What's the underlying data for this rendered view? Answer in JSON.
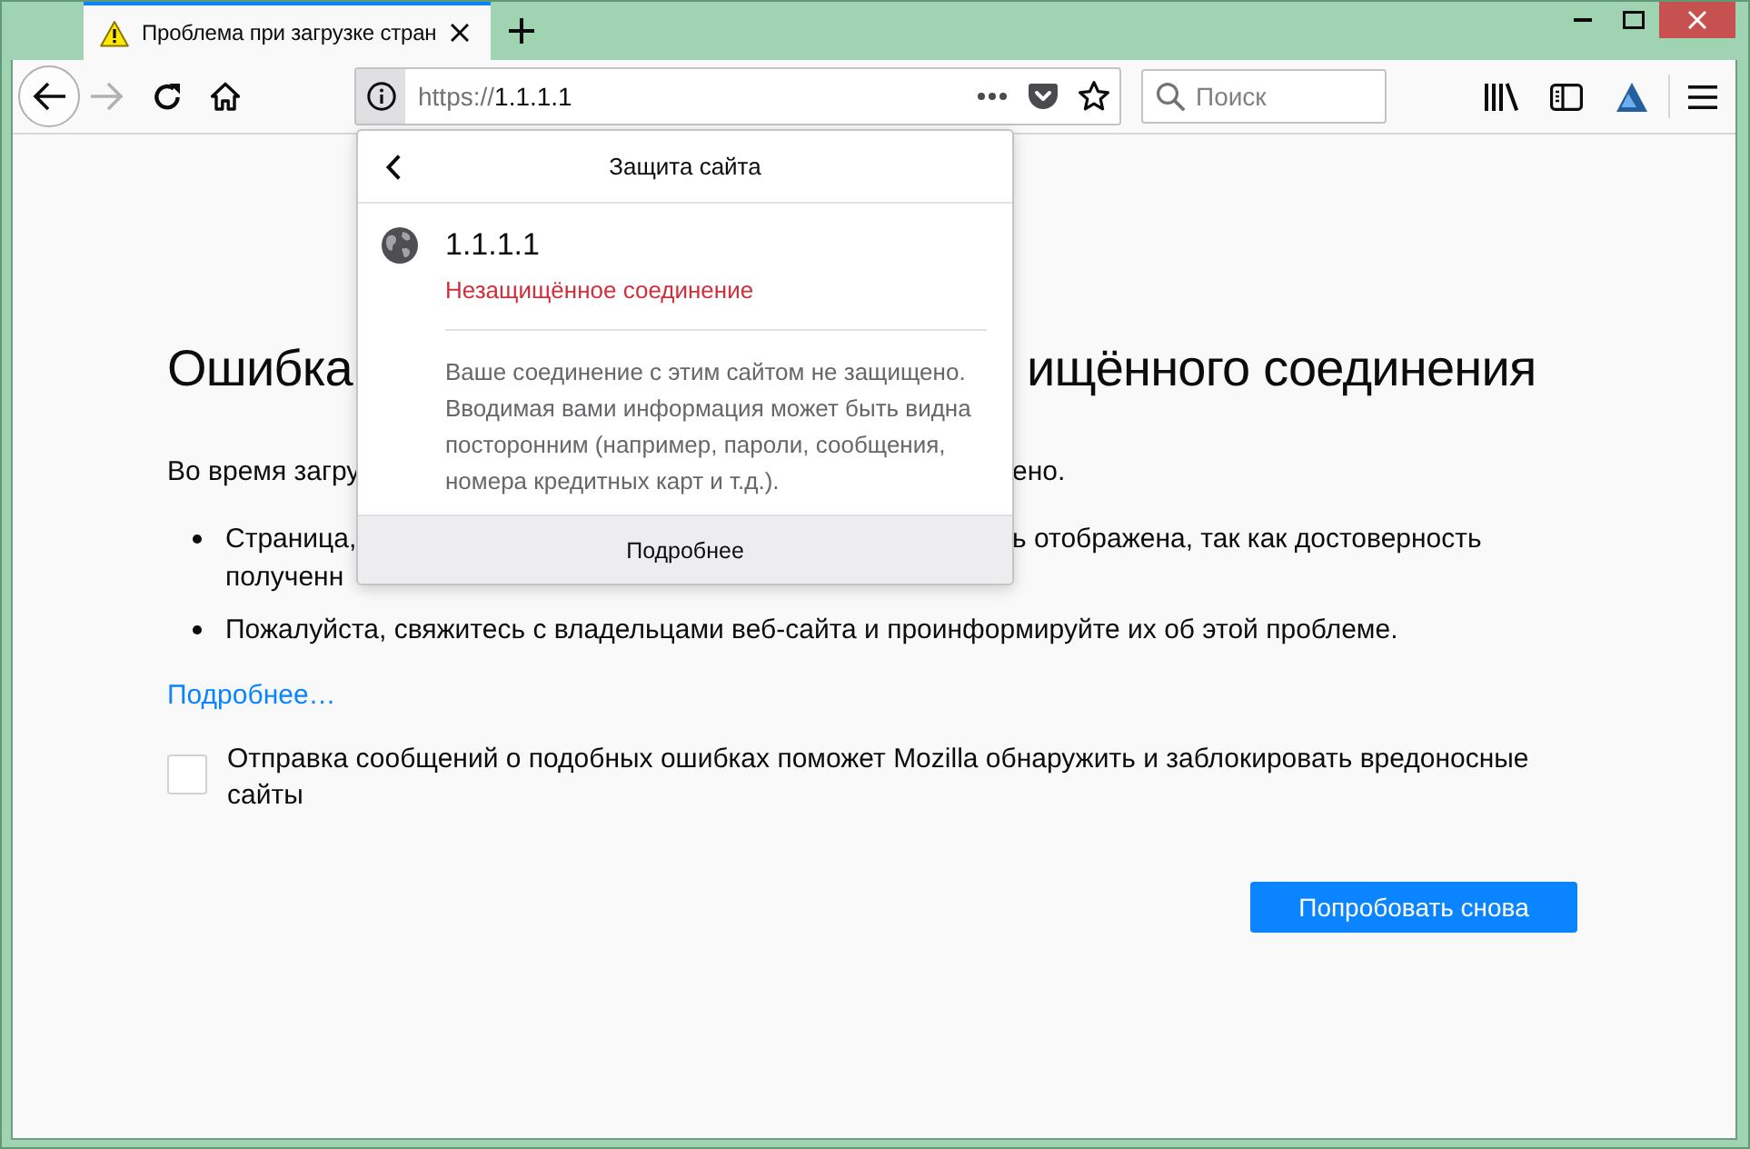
{
  "tabs": [
    {
      "title": "Проблема при загрузке стран",
      "selected": true
    }
  ],
  "toolbar": {
    "nav": [
      {
        "kind": "back",
        "disabled": false
      },
      {
        "kind": "forward",
        "disabled": true
      },
      {
        "kind": "reload",
        "disabled": false
      },
      {
        "kind": "home",
        "disabled": false
      }
    ],
    "address": {
      "scheme": "https://",
      "host": "1.1.1.1",
      "identity_open": true
    },
    "search": {
      "placeholder": "Поиск"
    }
  },
  "site_panel": {
    "title": "Защита сайта",
    "site": "1.1.1.1",
    "connection": {
      "label": "Незащищённое соединение",
      "secure": false
    },
    "description": "Ваше соединение с этим сайтом не защищено. Вводимая вами информация может быть видна посторонним (например, пароли, сообщения, номера кредитных карт и т.д.).",
    "more_button": "Подробнее"
  },
  "page": {
    "heading": [
      "Ошибка",
      "ищённого соединения"
    ],
    "intro": [
      "Во время загру",
      "ено."
    ],
    "bullets": [
      {
        "lines": [
          [
            "Страница,",
            "ь отображена, так как достоверность"
          ],
          [
            "полученн"
          ]
        ]
      },
      {
        "lines": [
          [
            "Пожалуйста, свяжитесь с владельцами веб-сайта и проинформируйте их об этой проблеме."
          ]
        ]
      }
    ],
    "more_link": "Подробнее…",
    "report": {
      "label": "Отправка сообщений о подобных ошибках поможет Mozilla обнаружить и заблокировать вредоносные сайты",
      "checked": false
    },
    "retry_button": "Попробовать снова"
  }
}
